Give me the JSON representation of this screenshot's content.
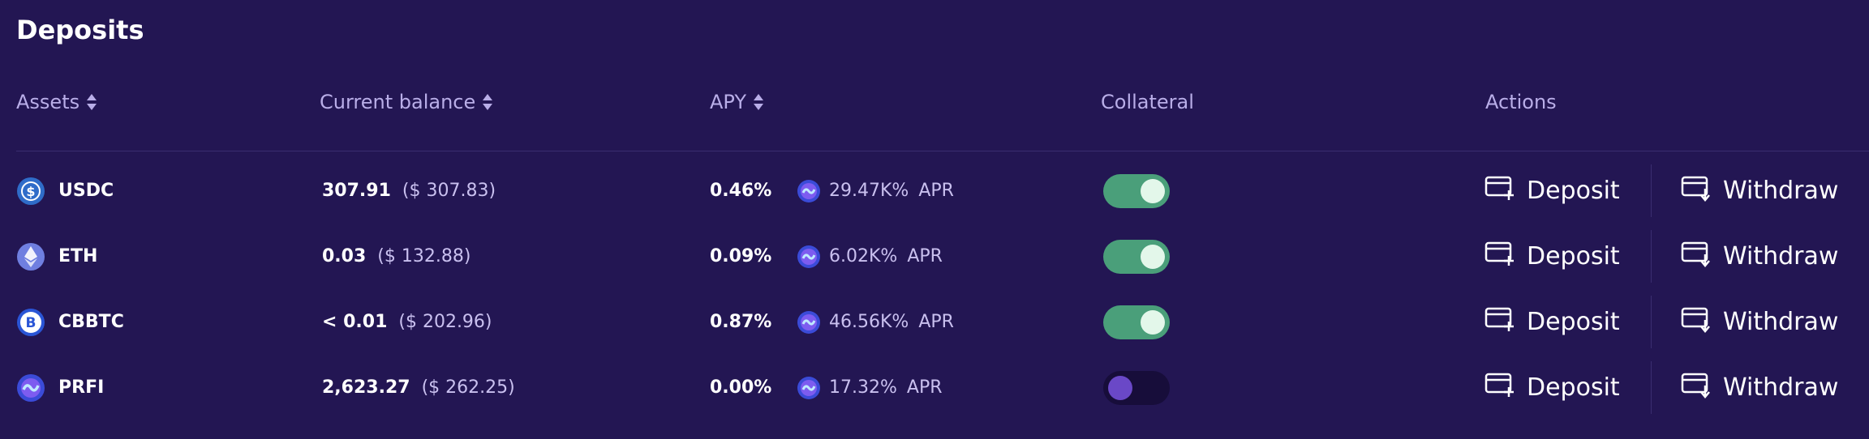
{
  "title": "Deposits",
  "headers": {
    "assets": "Assets",
    "current_balance": "Current balance",
    "apy": "APY",
    "collateral": "Collateral",
    "actions": "Actions"
  },
  "actions": {
    "deposit": "Deposit",
    "withdraw": "Withdraw"
  },
  "apr_suffix": "APR",
  "colors": {
    "background": "#231653",
    "header_text": "#b9aee8",
    "toggle_on": "#4a9f7a",
    "toggle_off": "#170d3a"
  },
  "rows": [
    {
      "symbol": "USDC",
      "icon": "usdc-icon",
      "balance": "307.91",
      "balance_usd": "($ 307.83)",
      "apy": "0.46%",
      "reward": "29.47K%",
      "collateral": true
    },
    {
      "symbol": "ETH",
      "icon": "eth-icon",
      "balance": "0.03",
      "balance_usd": "($ 132.88)",
      "apy": "0.09%",
      "reward": "6.02K%",
      "collateral": true
    },
    {
      "symbol": "CBBTC",
      "icon": "cbbtc-icon",
      "balance": "< 0.01",
      "balance_usd": "($ 202.96)",
      "apy": "0.87%",
      "reward": "46.56K%",
      "collateral": true
    },
    {
      "symbol": "PRFI",
      "icon": "prfi-icon",
      "balance": "2,623.27",
      "balance_usd": "($ 262.25)",
      "apy": "0.00%",
      "reward": "17.32%",
      "collateral": false
    }
  ]
}
